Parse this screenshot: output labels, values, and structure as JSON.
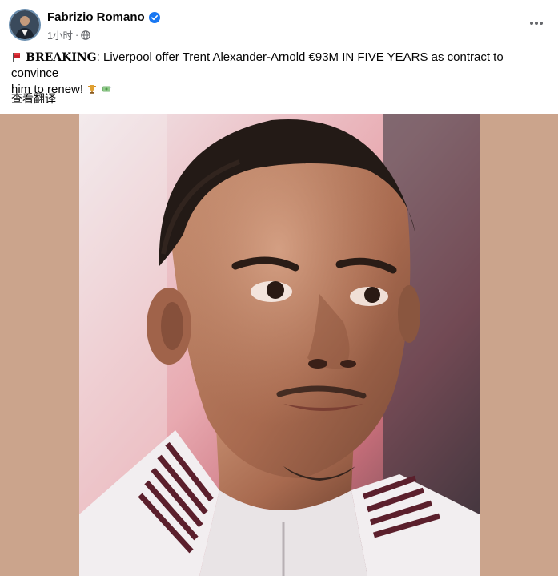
{
  "post": {
    "author": {
      "name": "Fabrizio Romano",
      "verified": true,
      "avatar_icon": "avatar-photo"
    },
    "meta": {
      "time": "1小时",
      "separator": "·",
      "audience_icon": "globe-icon"
    },
    "more_icon": "ellipsis-icon",
    "text": {
      "flag_emoji": "flag-icon",
      "breaking": "BREAKING",
      "colon": ":",
      "line1": " Liverpool offer Trent Alexander-Arnold €93M IN FIVE YEARS as contract to convince",
      "line2": "him to renew! ",
      "end_emojis": [
        "trophy-icon",
        "money-icon"
      ]
    },
    "translate_label": "查看翻译",
    "media": {
      "background_color": "#cba48c",
      "photo_subject": "player-portrait"
    }
  },
  "colors": {
    "text": "#050505",
    "secondary": "#65676b",
    "verified": "#1877f2",
    "media_bg": "#cba48c"
  }
}
